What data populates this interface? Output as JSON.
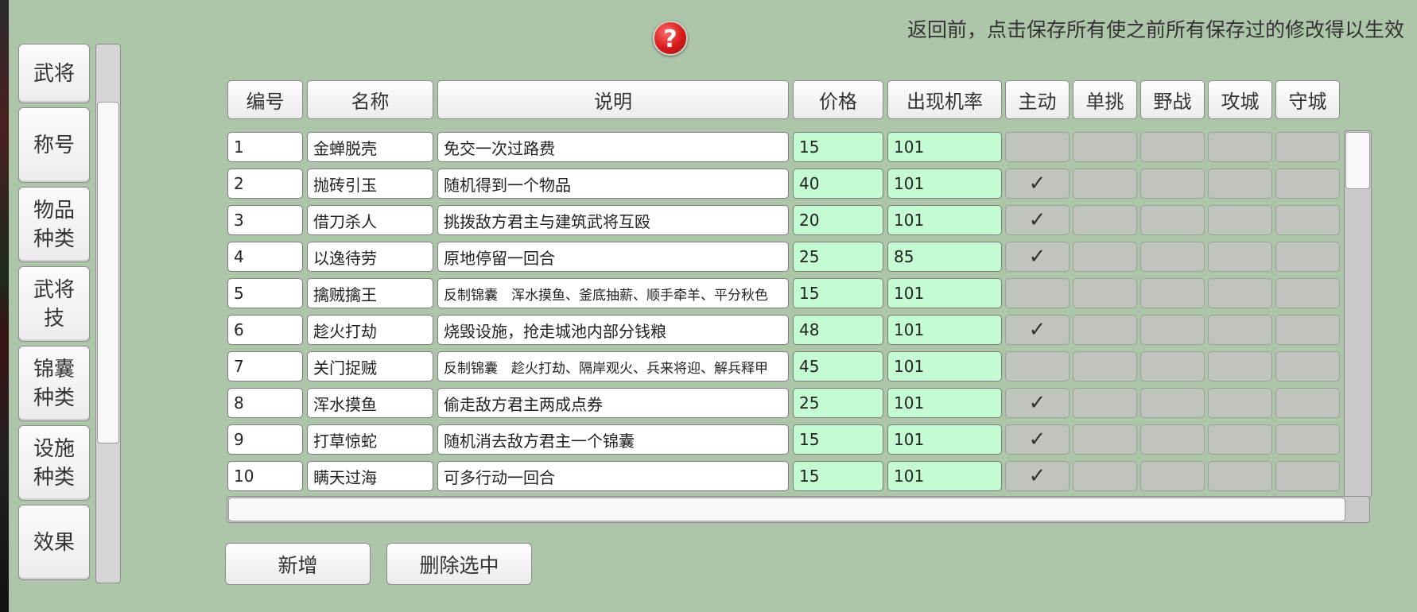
{
  "notice": "返回前，点击保存所有使之前所有保存过的修改得以生效",
  "help_icon": "question-icon",
  "sidebar": {
    "items": [
      "武将",
      "称号",
      "物品\n种类",
      "武将\n技",
      "锦囊\n种类",
      "设施\n种类",
      "效果"
    ]
  },
  "table": {
    "headers": [
      "编号",
      "名称",
      "说明",
      "价格",
      "出现机率",
      "主动",
      "单挑",
      "野战",
      "攻城",
      "守城"
    ],
    "rows": [
      {
        "id": "1",
        "name": "金蝉脱壳",
        "desc": "免交一次过路费",
        "price": "15",
        "rate": "101",
        "active": ""
      },
      {
        "id": "2",
        "name": "抛砖引玉",
        "desc": "随机得到一个物品",
        "price": "40",
        "rate": "101",
        "active": "✓"
      },
      {
        "id": "3",
        "name": "借刀杀人",
        "desc": "挑拨敌方君主与建筑武将互殴",
        "price": "20",
        "rate": "101",
        "active": "✓"
      },
      {
        "id": "4",
        "name": "以逸待劳",
        "desc": "原地停留一回合",
        "price": "25",
        "rate": "85",
        "active": "✓"
      },
      {
        "id": "5",
        "name": "擒贼擒王",
        "desc": "反制锦囊　浑水摸鱼、釜底抽薪、顺手牵羊、平分秋色",
        "price": "15",
        "rate": "101",
        "active": ""
      },
      {
        "id": "6",
        "name": "趁火打劫",
        "desc": "烧毁设施，抢走城池内部分钱粮",
        "price": "48",
        "rate": "101",
        "active": "✓"
      },
      {
        "id": "7",
        "name": "关门捉贼",
        "desc": "反制锦囊　趁火打劫、隔岸观火、兵来将迎、解兵释甲",
        "price": "45",
        "rate": "101",
        "active": ""
      },
      {
        "id": "8",
        "name": "浑水摸鱼",
        "desc": "偷走敌方君主两成点券",
        "price": "25",
        "rate": "101",
        "active": "✓"
      },
      {
        "id": "9",
        "name": "打草惊蛇",
        "desc": "随机消去敌方君主一个锦囊",
        "price": "15",
        "rate": "101",
        "active": "✓"
      },
      {
        "id": "10",
        "name": "瞒天过海",
        "desc": "可多行动一回合",
        "price": "15",
        "rate": "101",
        "active": "✓"
      }
    ]
  },
  "buttons": {
    "add": "新增",
    "delete_selected": "删除选中"
  },
  "colors": {
    "background": "#adc5a8",
    "editable_green": "#c4fbd2",
    "disabled_gray": "#bfc4bd"
  }
}
